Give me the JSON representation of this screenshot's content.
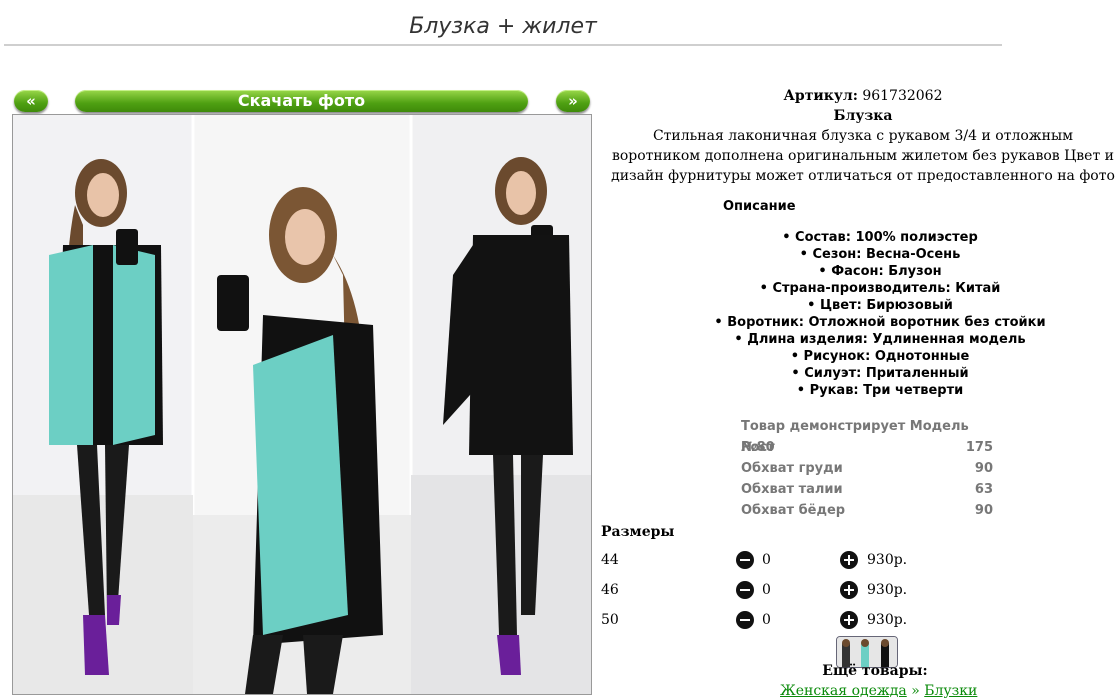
{
  "page": {
    "title": "Блузка + жилет"
  },
  "nav": {
    "prev_label": "«",
    "download_label": "Скачать фото",
    "next_label": "»"
  },
  "product": {
    "article_label": "Артикул:",
    "article_value": "961732062",
    "name": "Блузка",
    "description": "Стильная лаконичная блузка с рукавом 3/4 и отложным воротником дополнена оригинальным жилетом без рукавов Цвет и дизайн фурнитуры может отличаться от предоставленного на фото"
  },
  "specs": {
    "heading": "Описание",
    "items": [
      "• Состав: 100% полиэстер",
      "• Сезон: Весна-Осень",
      "• Фасон: Блузон",
      "• Страна-производитель: Китай",
      "• Цвет: Бирюзовый",
      "• Воротник: Отложной воротник без стойки",
      "• Длина изделия: Удлиненная модель",
      "• Рисунок: Однотонные",
      "• Силуэт: Приталенный",
      "• Рукав: Три четверти"
    ]
  },
  "model": {
    "heading": "Товар демонстрирует Модель №80",
    "rows": [
      {
        "label": "Рост",
        "value": "175"
      },
      {
        "label": "Обхват груди",
        "value": "90"
      },
      {
        "label": "Обхват талии",
        "value": "63"
      },
      {
        "label": "Обхват бёдер",
        "value": "90"
      }
    ]
  },
  "sizes": {
    "heading": "Размеры",
    "rows": [
      {
        "size": "44",
        "qty": "0",
        "price": "930р."
      },
      {
        "size": "46",
        "qty": "0",
        "price": "930р."
      },
      {
        "size": "50",
        "qty": "0",
        "price": "930р."
      }
    ]
  },
  "more": {
    "heading": "Ещё товары:",
    "crumb_1": "Женская одежда",
    "separator": "»",
    "crumb_2": "Блузки"
  },
  "colors": {
    "button_green": "#4fa012",
    "link_green": "#0a8a0a",
    "vest_turquoise": "#6ccfc4"
  }
}
